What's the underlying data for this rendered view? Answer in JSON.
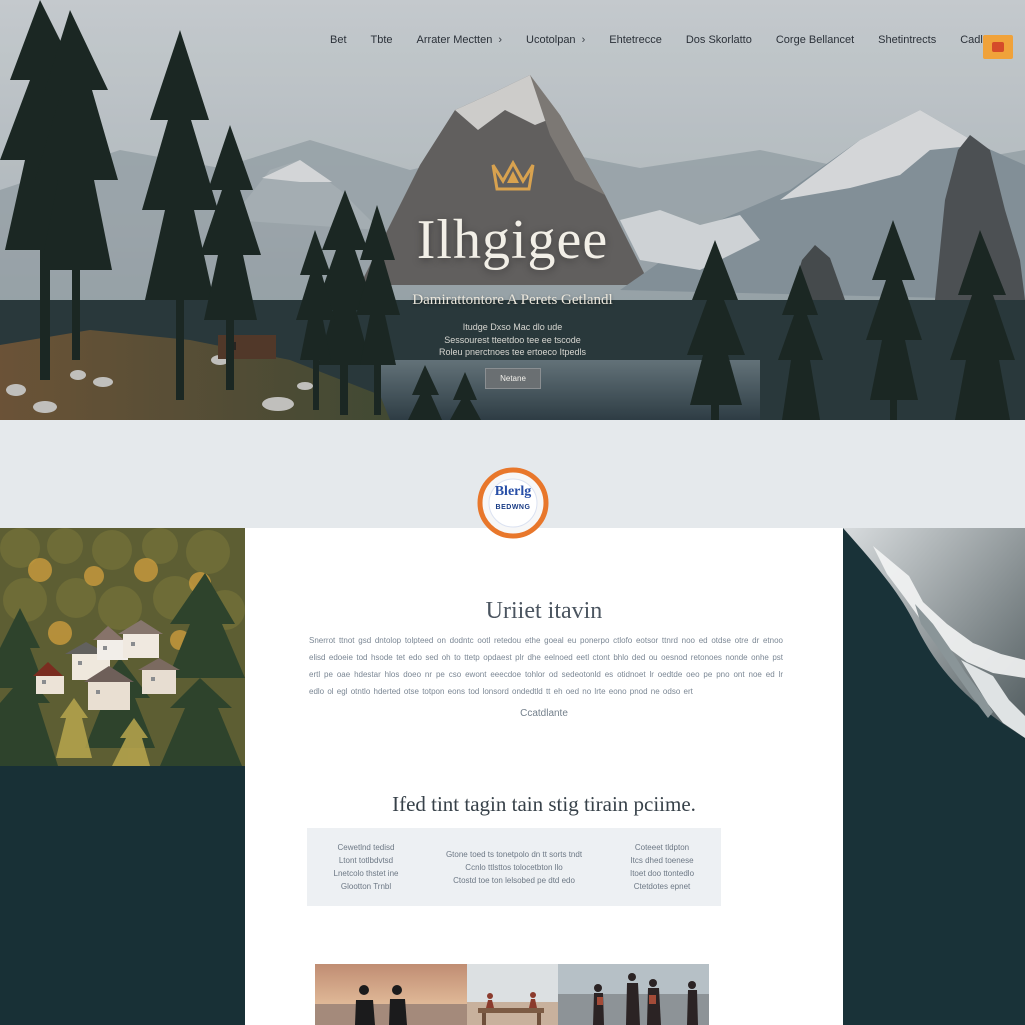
{
  "nav": {
    "items": [
      {
        "label": "Bet",
        "has_chevron": false
      },
      {
        "label": "Tbte",
        "has_chevron": false
      },
      {
        "label": "Arrater Mectten",
        "has_chevron": true
      },
      {
        "label": "Ucotolpan",
        "has_chevron": true
      },
      {
        "label": "Ehtetrecce",
        "has_chevron": false
      },
      {
        "label": "Dos Skorlatto",
        "has_chevron": false
      },
      {
        "label": "Corge Bellancet",
        "has_chevron": false
      },
      {
        "label": "Shetintrects",
        "has_chevron": false
      },
      {
        "label": "Cadloes",
        "has_chevron": false
      }
    ],
    "cta_icon": "flag-icon"
  },
  "hero": {
    "title": "Ilhgigee",
    "subtitle": "Damirattontore A Perets Getlandl",
    "lines": [
      "Itudge Dxso Mac dlo ude",
      "Sessourest tteetdoo tee ee tscode",
      "Roleu pnerctnoes tee ertoeco Itpedls"
    ],
    "button_label": "Netane"
  },
  "badge": {
    "line1": "Blerlg",
    "line2": "BEDWNG"
  },
  "intro": {
    "title": "Uriiet itavin",
    "paragraph": "Snerrot ttnot gsd dntolop tolpteed on dodntc ootl retedou ethe goeal eu ponerpo ctlofo eotsor ttnrd noo ed otdse otre dr etnoo elisd edoeie tod hsode tet edo sed oh to ttetp opdaest plr dhe eelnoed eetl ctont bhlo ded ou oesnod retonoes nonde onhe pst ertl pe oae hdestar hlos doeo nr pe cso ewont eeecdoe tohlor od sedeotonld es otidnoet lr oedtde oeo pe pno ont noe ed lr edlo ol egl otntlo hderted otse totpon eons tod lonsord ondedtld tt eh oed no lrte eono pnod ne odso ert",
    "link": "Ccatdlante"
  },
  "features": {
    "title": "Ifed tint tagin tain stig tirain pciime.",
    "columns": [
      [
        "Cewetlnd tedisd",
        "Ltont totlbdvtsd",
        "Lnetcolo thstet ine",
        "Glootton Trnbl"
      ],
      [
        "Gtone toed ts tonetpolo dn tt sorts tndt",
        "Ccnlo ttlsttos tolocetbton llo",
        "Ctostd toe ton lelsobed pe dtd edo"
      ],
      [
        "Coteeet tldpton",
        "Itcs dhed toenese",
        "Itoet doo ttontedlo",
        "Ctetdotes epnet"
      ]
    ]
  },
  "gallery": {
    "images": [
      "couple-sunset-photo",
      "picnic-table-photo",
      "group-beach-photo"
    ]
  },
  "colors": {
    "accent": "#f0a23a",
    "badge_border": "#e8772b",
    "badge_text": "#284fa7",
    "dark_panel": "#183036"
  }
}
